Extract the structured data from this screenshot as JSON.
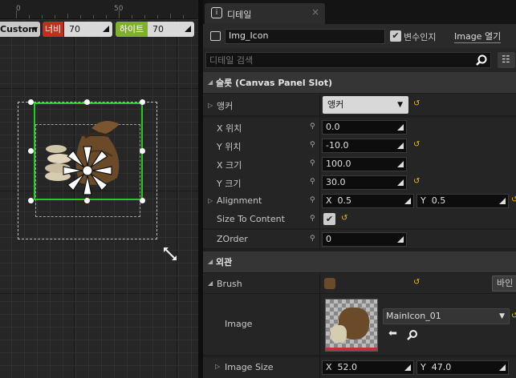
{
  "canvas": {
    "ruler_labels": [
      "0",
      "50"
    ],
    "size_mode": "Custom",
    "width_label": "너비",
    "width_value": "70",
    "height_label": "하이트",
    "height_value": "70"
  },
  "details": {
    "tab_title": "디테일",
    "widget_name": "Img_Icon",
    "is_variable_label": "변수인지",
    "is_variable_checked": true,
    "open_image_label": "Image 열기",
    "search_placeholder": "디테일 검색",
    "slot_section": "슬롯 (Canvas Panel Slot)",
    "anchor_label": "앵커",
    "anchor_value": "앵커",
    "pos_x_label": "X 위치",
    "pos_x_value": "0.0",
    "pos_y_label": "Y 위치",
    "pos_y_value": "-10.0",
    "size_x_label": "X 크기",
    "size_x_value": "100.0",
    "size_y_label": "Y 크기",
    "size_y_value": "30.0",
    "alignment_label": "Alignment",
    "alignment_x_prefix": "X",
    "alignment_x": "0.5",
    "alignment_y_prefix": "Y",
    "alignment_y": "0.5",
    "size_to_content_label": "Size To Content",
    "size_to_content_checked": true,
    "zorder_label": "ZOrder",
    "zorder_value": "0",
    "appearance_section": "외관",
    "brush_label": "Brush",
    "bind_label": "바인",
    "image_label": "Image",
    "image_asset": "MainIcon_01",
    "image_size_label": "Image Size",
    "image_size_x_prefix": "X",
    "image_size_x": "52.0",
    "image_size_y_prefix": "Y",
    "image_size_y": "47.0"
  },
  "colors": {
    "accent_yellow": "#e0c010",
    "width_red": "#c0301e",
    "height_green": "#7fb02a",
    "selection_green": "#22cc22"
  }
}
